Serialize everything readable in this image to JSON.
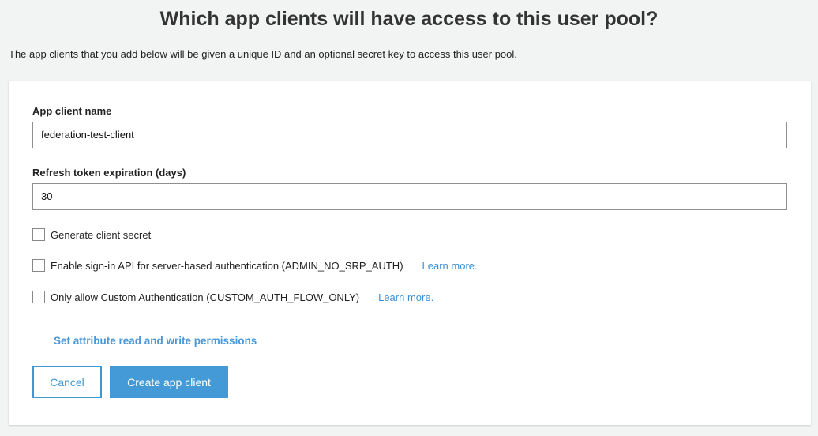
{
  "title": "Which app clients will have access to this user pool?",
  "subtitle": "The app clients that you add below will be given a unique ID and an optional secret key to access this user pool.",
  "form": {
    "name_label": "App client name",
    "name_value": "federation-test-client",
    "refresh_label": "Refresh token expiration (days)",
    "refresh_value": "30",
    "checkboxes": [
      {
        "label": "Generate client secret",
        "checked": false
      },
      {
        "label": "Enable sign-in API for server-based authentication (ADMIN_NO_SRP_AUTH)",
        "checked": false,
        "link": "Learn more."
      },
      {
        "label": "Only allow Custom Authentication (CUSTOM_AUTH_FLOW_ONLY)",
        "checked": false,
        "link": "Learn more."
      }
    ],
    "permissions_link": "Set attribute read and write permissions",
    "cancel_label": "Cancel",
    "create_label": "Create app client"
  },
  "colors": {
    "accent": "#449ad6",
    "background": "#f2f3f3"
  }
}
